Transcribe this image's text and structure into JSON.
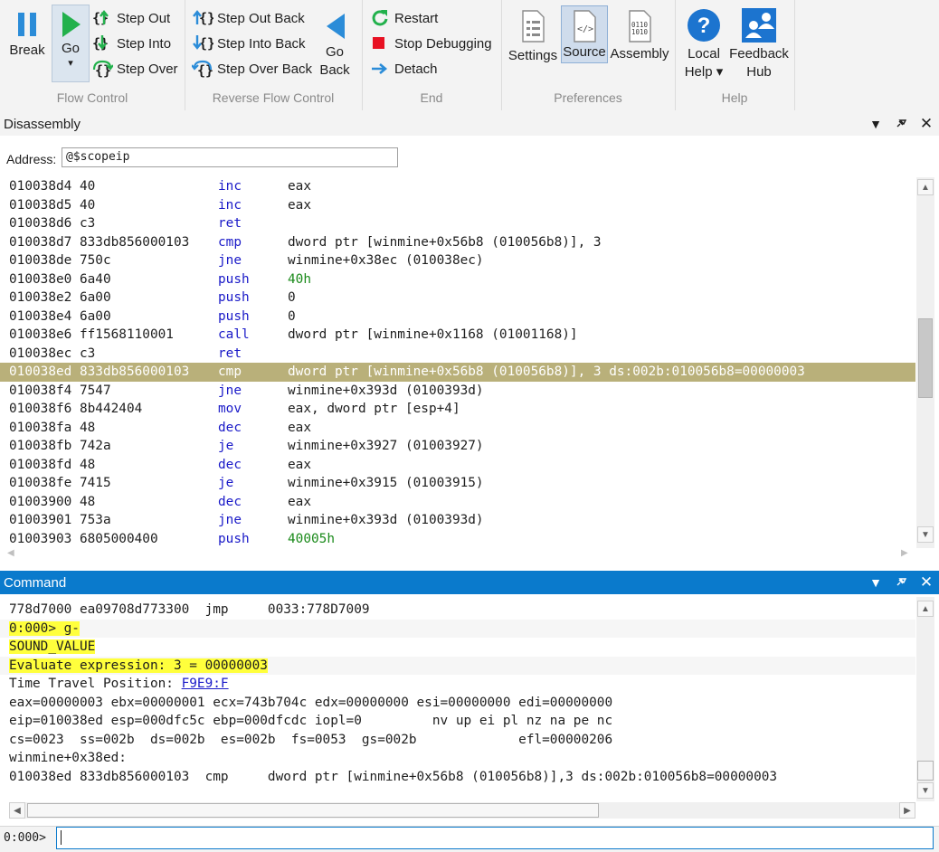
{
  "ribbon": {
    "break_label": "Break",
    "go_label": "Go",
    "go_dropdown": "▾",
    "step_out": "Step Out",
    "step_into": "Step Into",
    "step_over": "Step Over",
    "flow_control": "Flow Control",
    "step_out_back": "Step Out Back",
    "step_into_back": "Step Into Back",
    "step_over_back": "Step Over Back",
    "go_back_1": "Go",
    "go_back_2": "Back",
    "reverse_flow_control": "Reverse Flow Control",
    "restart": "Restart",
    "stop_debugging": "Stop Debugging",
    "detach": "Detach",
    "end": "End",
    "settings": "Settings",
    "source": "Source",
    "assembly": "Assembly",
    "preferences": "Preferences",
    "local_help_1": "Local",
    "local_help_2": "Help ▾",
    "feedback_1": "Feedback",
    "feedback_2": "Hub",
    "help": "Help"
  },
  "colors": {
    "accent": "#0a7acc",
    "highlight_row": "#b9b07a",
    "mnemonic": "#1a1ac8",
    "immediate": "#1a8a1a",
    "yellow_highlight": "#ffff3c"
  },
  "disassembly": {
    "title": "Disassembly",
    "address_label": "Address:",
    "address_value": "@$scopeip",
    "rows": [
      {
        "addr": "010038d4 40",
        "mn": "inc",
        "op": "eax"
      },
      {
        "addr": "010038d5 40",
        "mn": "inc",
        "op": "eax"
      },
      {
        "addr": "010038d6 c3",
        "mn": "ret",
        "op": ""
      },
      {
        "addr": "010038d7 833db856000103",
        "mn": "cmp",
        "op": "dword ptr [winmine+0x56b8 (010056b8)], 3"
      },
      {
        "addr": "010038de 750c",
        "mn": "jne",
        "op": "winmine+0x38ec (010038ec)"
      },
      {
        "addr": "010038e0 6a40",
        "mn": "push",
        "op": "40h",
        "num": true
      },
      {
        "addr": "010038e2 6a00",
        "mn": "push",
        "op": "0"
      },
      {
        "addr": "010038e4 6a00",
        "mn": "push",
        "op": "0"
      },
      {
        "addr": "010038e6 ff1568110001",
        "mn": "call",
        "op": "dword ptr [winmine+0x1168 (01001168)]"
      },
      {
        "addr": "010038ec c3",
        "mn": "ret",
        "op": ""
      },
      {
        "addr": "010038ed 833db856000103",
        "mn": "cmp",
        "op": "dword ptr [winmine+0x56b8 (010056b8)], 3 ds:002b:010056b8=00000003",
        "hl": true
      },
      {
        "addr": "010038f4 7547",
        "mn": "jne",
        "op": "winmine+0x393d (0100393d)"
      },
      {
        "addr": "010038f6 8b442404",
        "mn": "mov",
        "op": "eax, dword ptr [esp+4]"
      },
      {
        "addr": "010038fa 48",
        "mn": "dec",
        "op": "eax"
      },
      {
        "addr": "010038fb 742a",
        "mn": "je",
        "op": "winmine+0x3927 (01003927)"
      },
      {
        "addr": "010038fd 48",
        "mn": "dec",
        "op": "eax"
      },
      {
        "addr": "010038fe 7415",
        "mn": "je",
        "op": "winmine+0x3915 (01003915)"
      },
      {
        "addr": "01003900 48",
        "mn": "dec",
        "op": "eax"
      },
      {
        "addr": "01003901 753a",
        "mn": "jne",
        "op": "winmine+0x393d (0100393d)"
      },
      {
        "addr": "01003903 6805000400",
        "mn": "push",
        "op": "40005h",
        "num": true
      }
    ]
  },
  "command": {
    "title": "Command",
    "lines": [
      {
        "text": "778d7000 ea09708d773300  jmp     0033:778D7009",
        "shade": false
      },
      {
        "text": "0:000> g-",
        "shade": true,
        "yellow": true
      },
      {
        "text": "SOUND_VALUE",
        "shade": false,
        "yellow": true
      },
      {
        "text": "Evaluate expression: 3 = 00000003",
        "shade": true,
        "yellow": true
      },
      {
        "text": "Time Travel Position: ",
        "link": "F9E9:F",
        "shade": false
      },
      {
        "text": "eax=00000003 ebx=00000001 ecx=743b704c edx=00000000 esi=00000000 edi=00000000",
        "shade": false
      },
      {
        "text": "eip=010038ed esp=000dfc5c ebp=000dfcdc iopl=0         nv up ei pl nz na pe nc",
        "shade": false
      },
      {
        "text": "cs=0023  ss=002b  ds=002b  es=002b  fs=0053  gs=002b             efl=00000206",
        "shade": false
      },
      {
        "text": "winmine+0x38ed:",
        "shade": false
      },
      {
        "text": "010038ed 833db856000103  cmp     dword ptr [winmine+0x56b8 (010056b8)],3 ds:002b:010056b8=00000003",
        "shade": false
      }
    ],
    "prompt_label": "0:000>",
    "prompt_value": ""
  }
}
